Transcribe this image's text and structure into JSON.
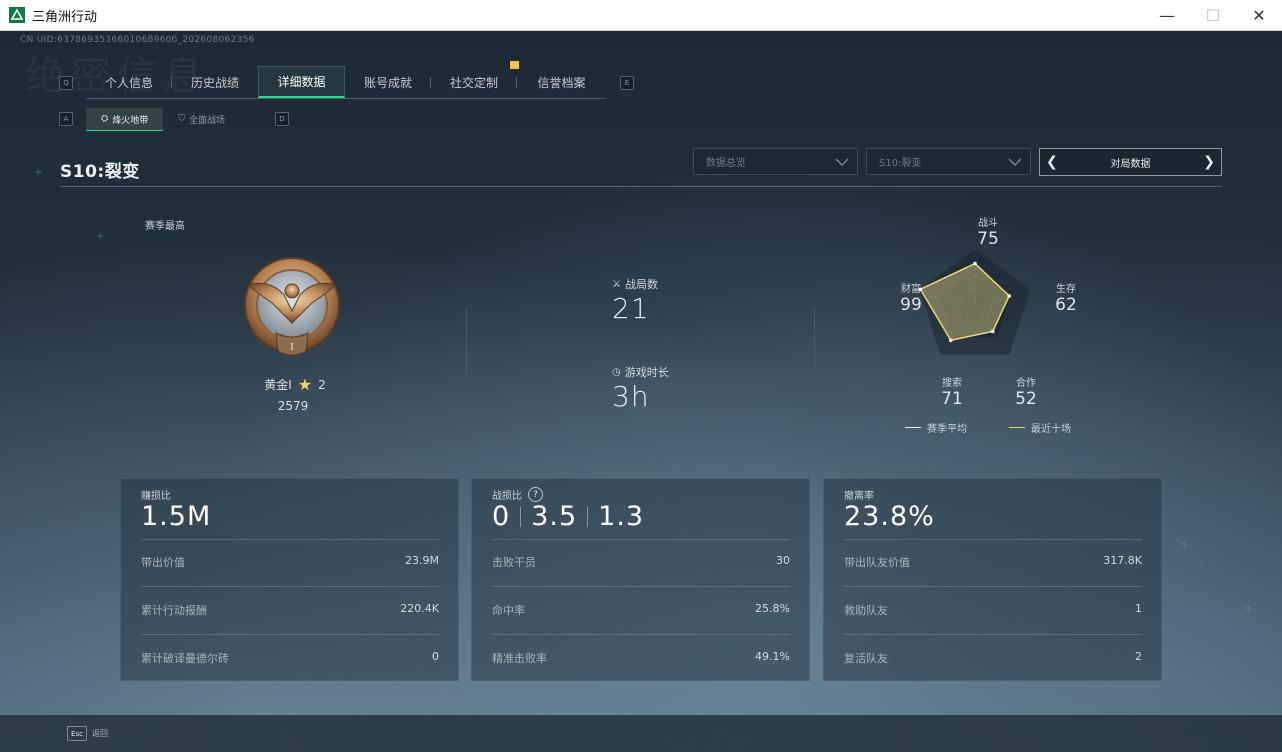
{
  "window": {
    "title": "三角洲行动",
    "controls": {
      "minimize": "—",
      "maximize": "☐",
      "close": "✕"
    },
    "accent": "#1fb36a"
  },
  "uid": "CN UID:6378693536601068960б_202608062356",
  "watermark": "绝密信息",
  "tabs": {
    "left_key": "Q",
    "right_key": "E",
    "items": [
      {
        "label": "个人信息"
      },
      {
        "label": "历史战绩"
      },
      {
        "label": "详细数据",
        "active": true
      },
      {
        "label": "账号成就"
      },
      {
        "label": "社交定制",
        "badge": true
      },
      {
        "label": "信誉档案"
      }
    ]
  },
  "subtabs": {
    "left_key": "A",
    "right_key": "D",
    "items": [
      {
        "label": "烽火地带",
        "active": true
      },
      {
        "label": "全面战场"
      }
    ]
  },
  "season_title": "S10:裂变",
  "filters": {
    "data_overview": "数据总览",
    "season": "S10:裂变",
    "mode": "对局数据"
  },
  "rank": {
    "label": "赛季最高",
    "tier": "黄金Ⅰ",
    "stars": "2",
    "score": "2579",
    "numeral": "I"
  },
  "summary": {
    "matches_label": "战局数",
    "matches_value": "21",
    "time_label": "游戏时长",
    "time_value": "3h"
  },
  "radar": {
    "axes": [
      {
        "name": "战斗",
        "value": "75"
      },
      {
        "name": "生存",
        "value": "62"
      },
      {
        "name": "合作",
        "value": "52"
      },
      {
        "name": "搜索",
        "value": "71"
      },
      {
        "name": "财富",
        "value": "99"
      }
    ],
    "legend_avg": "赛季平均",
    "legend_recent": "最近十场",
    "avg_color": "#e8eef2",
    "recent_color": "#f2d36b"
  },
  "cards": {
    "profit": {
      "label": "赚损比",
      "value": "1.5M",
      "rows": [
        {
          "k": "带出价值",
          "v": "23.9M"
        },
        {
          "k": "累计行动报酬",
          "v": "220.4K"
        },
        {
          "k": "累计破译曼德尔砖",
          "v": "0"
        }
      ]
    },
    "combat": {
      "label": "战损比",
      "help": "?",
      "values": [
        "0",
        "3.5",
        "1.3"
      ],
      "rows": [
        {
          "k": "击败干员",
          "v": "30"
        },
        {
          "k": "命中率",
          "v": "25.8%"
        },
        {
          "k": "精准击败率",
          "v": "49.1%"
        }
      ]
    },
    "extract": {
      "label": "撤离率",
      "value": "23.8%",
      "rows": [
        {
          "k": "带出队友价值",
          "v": "317.8K"
        },
        {
          "k": "救助队友",
          "v": "1"
        },
        {
          "k": "复活队友",
          "v": "2"
        }
      ]
    }
  },
  "footer": {
    "esc_key": "Esc",
    "back_label": "返回"
  }
}
